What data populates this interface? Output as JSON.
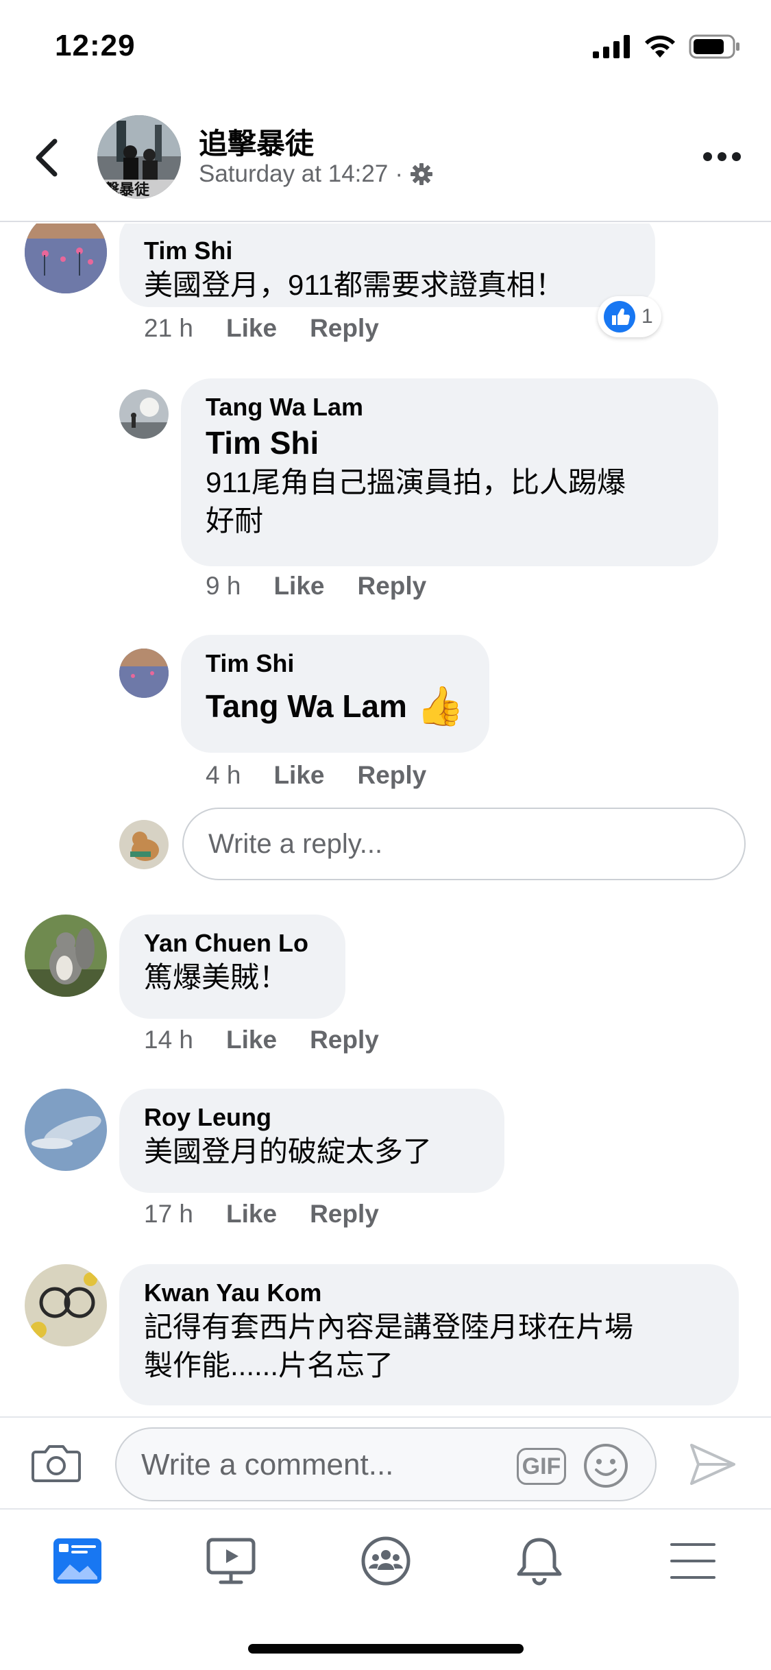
{
  "status_bar": {
    "time": "12:29"
  },
  "header": {
    "group_name": "追擊暴徒",
    "timestamp": "Saturday at 14:27",
    "separator": "·"
  },
  "comments": [
    {
      "author": "Tim  Shi",
      "text": "美國登月，911都需要求證真相！",
      "time": "21 h",
      "like_label": "Like",
      "reply_label": "Reply",
      "reaction_count": "1",
      "replies": [
        {
          "author": "Tang Wa Lam",
          "mention": "Tim  Shi",
          "text_line1": "911尾角自己搵演員拍，比人踢爆",
          "text_line2": "好耐",
          "time": "9 h",
          "like_label": "Like",
          "reply_label": "Reply"
        },
        {
          "author": "Tim  Shi",
          "mention": "Tang Wa Lam",
          "emoji": "👍",
          "time": "4 h",
          "like_label": "Like",
          "reply_label": "Reply"
        }
      ],
      "reply_placeholder": "Write a reply..."
    },
    {
      "author": "Yan Chuen Lo",
      "text": "篤爆美賊！",
      "time": "14 h",
      "like_label": "Like",
      "reply_label": "Reply"
    },
    {
      "author": "Roy Leung",
      "text": "美國登月的破綻太多了",
      "time": "17 h",
      "like_label": "Like",
      "reply_label": "Reply"
    },
    {
      "author": "Kwan Yau Kom",
      "text_line1": "記得有套西片內容是講登陸月球在片場",
      "text_line2": "製作能......片名忘了"
    }
  ],
  "composer": {
    "placeholder": "Write a comment...",
    "gif_label": "GIF"
  },
  "tabbar": {
    "tabs": [
      "news-feed-icon",
      "watch-icon",
      "groups-icon",
      "notifications-icon",
      "menu-icon"
    ],
    "active": 0
  },
  "colors": {
    "accent": "#1877f2",
    "bubble": "#f0f2f5",
    "secondary_text": "#65676b"
  }
}
